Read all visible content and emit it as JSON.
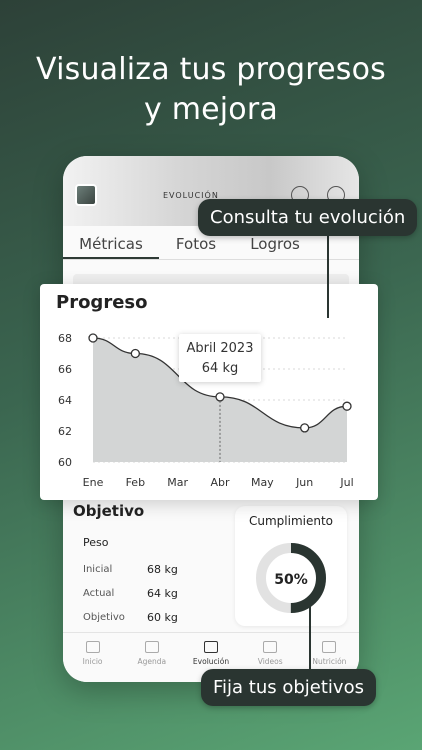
{
  "headline": {
    "line1": "Visualiza  tus progresos",
    "line2": "y mejora"
  },
  "phone": {
    "screen_title": "EVOLUCIÓN",
    "tabs": [
      {
        "label": "Métricas",
        "active": true
      },
      {
        "label": "Fotos",
        "active": false
      },
      {
        "label": "Logros",
        "active": false
      }
    ],
    "objective": {
      "title": "Objetivo",
      "subtitle": "Peso",
      "rows": [
        {
          "label": "Inicial",
          "value": "68 kg"
        },
        {
          "label": "Actual",
          "value": "64 kg"
        },
        {
          "label": "Objetivo",
          "value": "60 kg"
        }
      ]
    },
    "compliance": {
      "title": "Cumplimiento",
      "percent_label": "50%",
      "fraction": 0.5
    },
    "bottom_nav": [
      {
        "label": "Inicio",
        "icon": "home-icon",
        "active": false
      },
      {
        "label": "Agenda",
        "icon": "calendar-icon",
        "active": false
      },
      {
        "label": "Evolución",
        "icon": "chart-icon",
        "active": true
      },
      {
        "label": "Videos",
        "icon": "video-icon",
        "active": false
      },
      {
        "label": "Nutrición",
        "icon": "cutlery-icon",
        "active": false
      }
    ]
  },
  "progress_card": {
    "title": "Progreso",
    "tooltip": {
      "line1": "Abril 2023",
      "line2": "64 kg"
    }
  },
  "chart_data": {
    "type": "area",
    "title": "Progreso",
    "categories": [
      "Ene",
      "Feb",
      "Mar",
      "Abr",
      "May",
      "Jun",
      "Jul"
    ],
    "series": [
      {
        "values": [
          68,
          67,
          null,
          64.2,
          null,
          62.2,
          63.6
        ]
      }
    ],
    "yticks": [
      68,
      66,
      64,
      62,
      60
    ],
    "ylim": [
      60,
      68
    ],
    "grid": true,
    "highlighted_point": {
      "x": "Abr",
      "y": 64
    }
  },
  "callouts": {
    "top": "Consulta tu evolución",
    "bottom": "Fija tus objetivos"
  },
  "colors": {
    "dark": "#2a3531",
    "chart_fill": "#d3d5d5",
    "ring_dark": "#2a3531",
    "ring_light": "#e2e2e2"
  }
}
